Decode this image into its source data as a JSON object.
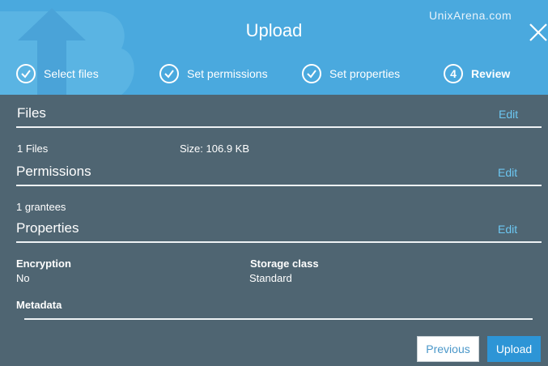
{
  "header": {
    "title": "Upload",
    "watermark": "UnixArena.com",
    "steps": [
      {
        "label": "Select files",
        "marker": "check"
      },
      {
        "label": "Set permissions",
        "marker": "check"
      },
      {
        "label": "Set properties",
        "marker": "check"
      },
      {
        "label": "Review",
        "marker": "4"
      }
    ]
  },
  "files": {
    "title": "Files",
    "edit": "Edit",
    "count": "1 Files",
    "size": "Size: 106.9 KB"
  },
  "permissions": {
    "title": "Permissions",
    "edit": "Edit",
    "grantees": "1 grantees"
  },
  "properties": {
    "title": "Properties",
    "edit": "Edit",
    "encryption_label": "Encryption",
    "encryption_value": "No",
    "storage_label": "Storage class",
    "storage_value": "Standard",
    "metadata_label": "Metadata"
  },
  "footer": {
    "previous": "Previous",
    "upload": "Upload"
  },
  "colors": {
    "header": "#4aa9de",
    "panel": "#4f6572",
    "link": "#6cc7f2",
    "primary": "#2d95d6"
  }
}
